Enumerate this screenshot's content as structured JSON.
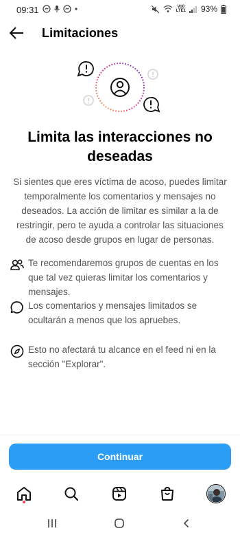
{
  "status_bar": {
    "time": "09:31",
    "battery": "93%",
    "network_label_top": "Vo0",
    "network_label_bottom": "LTE1"
  },
  "header": {
    "title": "Limitaciones"
  },
  "main": {
    "headline": "Limita las interacciones no deseadas",
    "intro": "Si sientes que eres víctima de acoso, puedes limitar temporalmente los comentarios y mensajes no deseados. La acción de limitar es similar a la de restringir, pero te ayuda a controlar las situaciones de acoso desde grupos en lugar de personas.",
    "features": [
      {
        "icon": "people-icon",
        "text": "Te recomendaremos grupos de cuentas en los que tal vez quieras limitar los comentarios y mensajes."
      },
      {
        "icon": "comment-bubble-icon",
        "text": "Los comentarios y mensajes limitados se ocultarán a menos que los apruebes."
      },
      {
        "icon": "compass-icon",
        "text": "Esto no afectará tu alcance en el feed ni en la sección \"Explorar\"."
      }
    ]
  },
  "footer": {
    "continue_label": "Continuar"
  },
  "tabbar": {
    "items": [
      "home-icon",
      "search-icon",
      "reels-icon",
      "shop-icon",
      "profile-avatar"
    ]
  },
  "colors": {
    "accent": "#2b9df4",
    "notification_dot": "#ed4956",
    "secondary_text": "#555555"
  }
}
